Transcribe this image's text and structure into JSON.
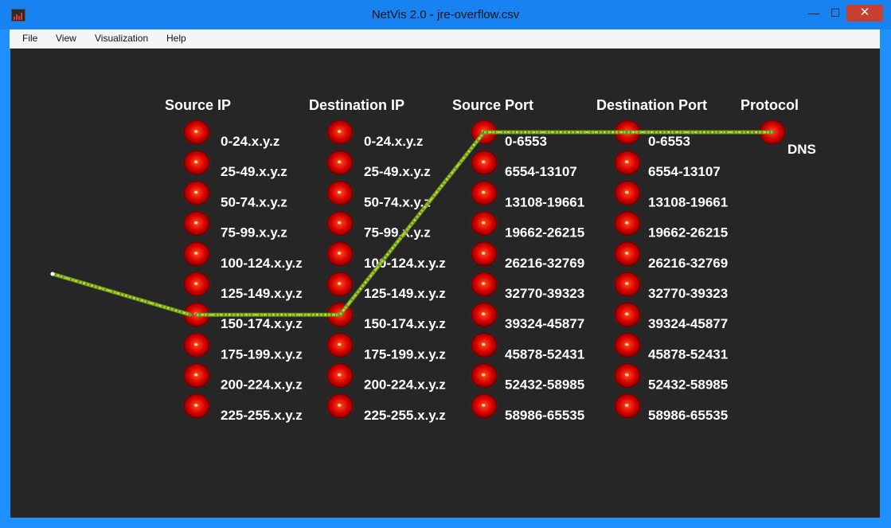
{
  "window": {
    "title": "NetVis 2.0 - jre-overflow.csv",
    "minimize_glyph": "—",
    "maximize_glyph": "☐",
    "close_glyph": "✕"
  },
  "menu": {
    "items": [
      "File",
      "View",
      "Visualization",
      "Help"
    ]
  },
  "visualization": {
    "columns": [
      {
        "title": "Source IP",
        "labels": [
          "0-24.x.y.z",
          "25-49.x.y.z",
          "50-74.x.y.z",
          "75-99.x.y.z",
          "100-124.x.y.z",
          "125-149.x.y.z",
          "150-174.x.y.z",
          "175-199.x.y.z",
          "200-224.x.y.z",
          "225-255.x.y.z"
        ]
      },
      {
        "title": "Destination IP",
        "labels": [
          "0-24.x.y.z",
          "25-49.x.y.z",
          "50-74.x.y.z",
          "75-99.x.y.z",
          "100-124.x.y.z",
          "125-149.x.y.z",
          "150-174.x.y.z",
          "175-199.x.y.z",
          "200-224.x.y.z",
          "225-255.x.y.z"
        ]
      },
      {
        "title": "Source Port",
        "labels": [
          "0-6553",
          "6554-13107",
          "13108-19661",
          "19662-26215",
          "26216-32769",
          "32770-39323",
          "39324-45877",
          "45878-52431",
          "52432-58985",
          "58986-65535"
        ]
      },
      {
        "title": "Destination Port",
        "labels": [
          "0-6553",
          "6554-13107",
          "13108-19661",
          "19662-26215",
          "26216-32769",
          "32770-39323",
          "39324-45877",
          "45878-52431",
          "52432-58985",
          "58986-65535"
        ]
      },
      {
        "title": "Protocol",
        "labels": [
          "DNS"
        ]
      }
    ],
    "active_path": [
      6,
      6,
      0,
      0,
      0
    ],
    "node_color": "#d40000",
    "line_colors": [
      "#9acd32",
      "#e6e600",
      "#6b8e23"
    ],
    "background_color": "#262626"
  }
}
